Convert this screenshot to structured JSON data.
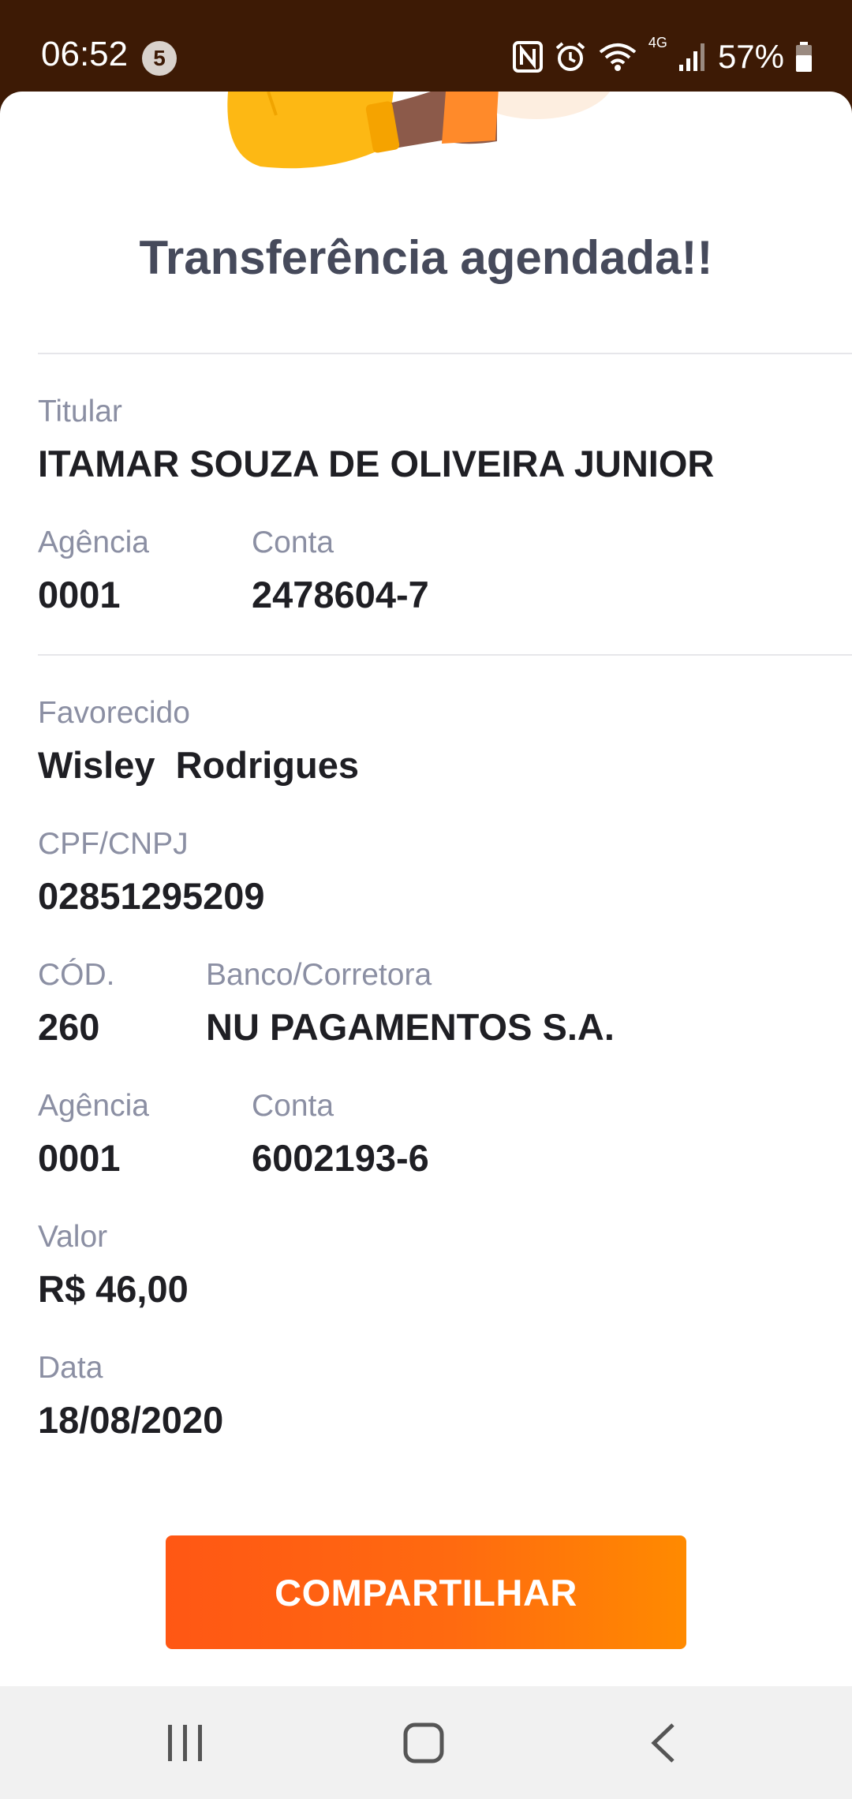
{
  "status_bar": {
    "time": "06:52",
    "notification_count": "5",
    "network_type": "4G",
    "battery_percent": "57%",
    "icons": [
      "nfc-icon",
      "alarm-icon",
      "wifi-icon",
      "signal-icon",
      "battery-icon"
    ]
  },
  "title": "Transferência agendada!!",
  "titular": {
    "label": "Titular",
    "name": "ITAMAR SOUZA DE OLIVEIRA JUNIOR",
    "agencia_label": "Agência",
    "agencia": "0001",
    "conta_label": "Conta",
    "conta": "2478604-7"
  },
  "favorecido": {
    "label": "Favorecido",
    "name": "Wisley  Rodrigues",
    "cpf_label": "CPF/CNPJ",
    "cpf": "02851295209",
    "cod_label": "CÓD.",
    "cod": "260",
    "banco_label": "Banco/Corretora",
    "banco": "NU PAGAMENTOS S.A.",
    "agencia_label": "Agência",
    "agencia": "0001",
    "conta_label": "Conta",
    "conta": "6002193-6",
    "valor_label": "Valor",
    "valor": "R$ 46,00",
    "data_label": "Data",
    "data": "18/08/2020"
  },
  "share_button": "COMPARTILHAR",
  "colors": {
    "status_bar": "#3d1a05",
    "accent_start": "#ff5714",
    "accent_end": "#ff8a00",
    "title": "#464a5b",
    "label": "#8b8fa3",
    "value": "#1f1f24"
  },
  "nav_bar": {
    "icons": [
      "recent-apps-icon",
      "home-icon",
      "back-icon"
    ]
  }
}
